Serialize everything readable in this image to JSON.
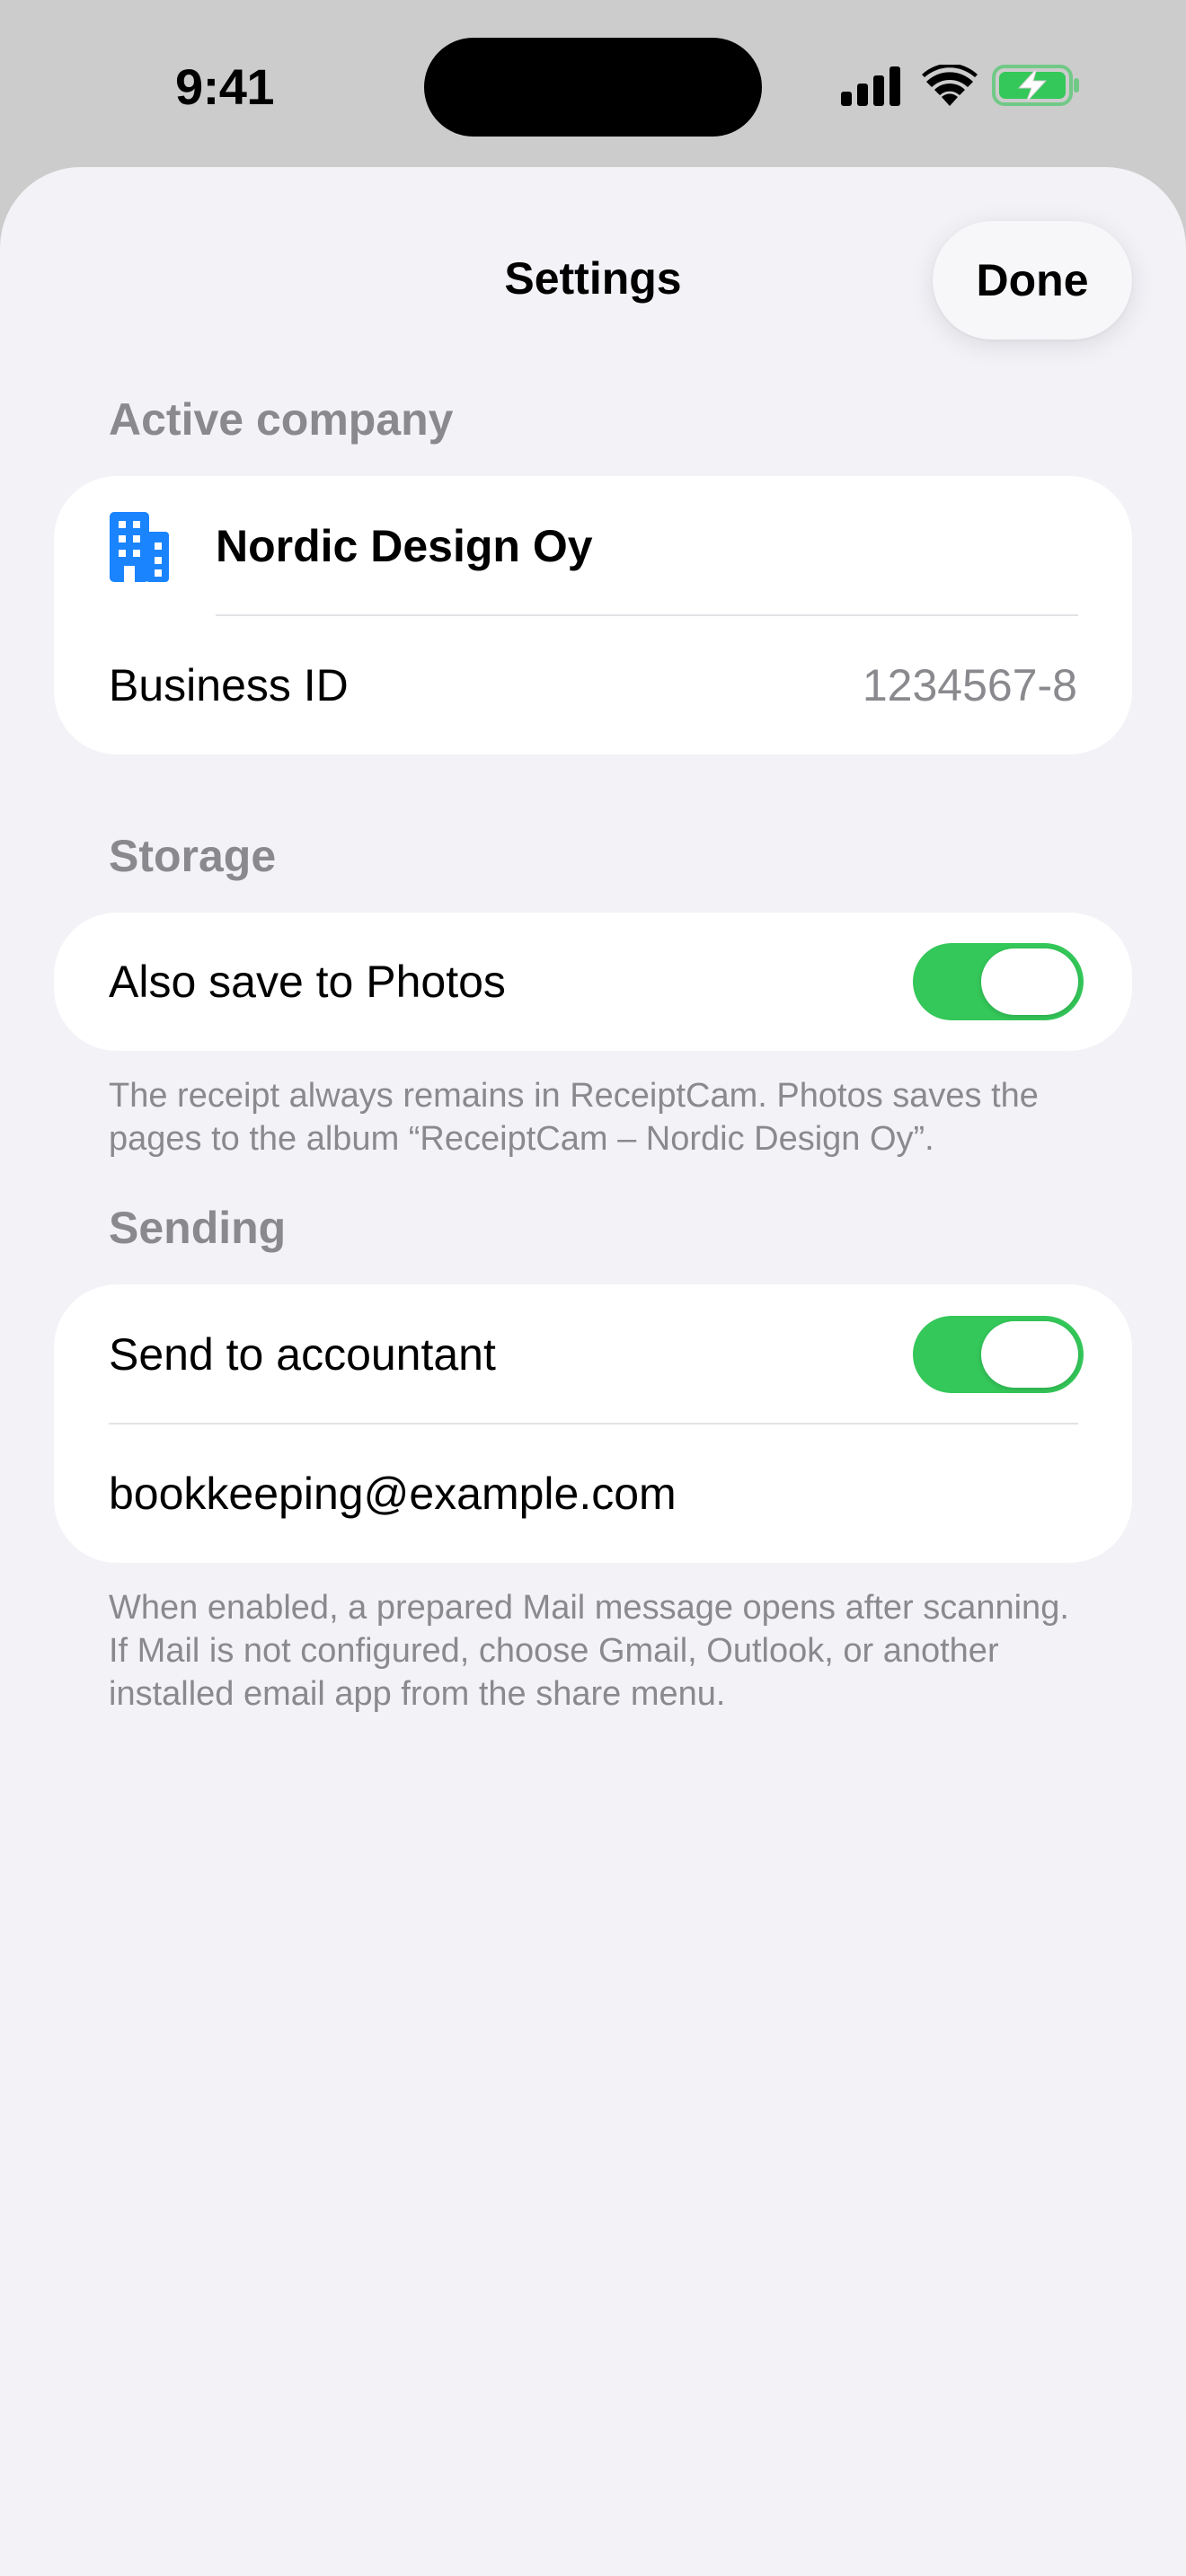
{
  "status_bar": {
    "time": "9:41",
    "icons": [
      "cellular-signal-icon",
      "wifi-icon",
      "battery-charging-icon"
    ],
    "battery_color": "#34c759"
  },
  "nav": {
    "title": "Settings",
    "done_label": "Done"
  },
  "active_company": {
    "header": "Active company",
    "company_icon": "building-icon",
    "company_name": "Nordic Design Oy",
    "business_id_label": "Business ID",
    "business_id_value": "1234567-8"
  },
  "storage": {
    "header": "Storage",
    "save_to_photos_label": "Also save to Photos",
    "save_to_photos_enabled": true,
    "note": "The receipt always remains in ReceiptCam. Photos saves the pages to the album “ReceiptCam – Nordic Design Oy”."
  },
  "sending": {
    "header": "Sending",
    "send_to_accountant_label": "Send to accountant",
    "send_to_accountant_enabled": true,
    "email": "bookkeeping@example.com",
    "note": "When enabled, a prepared Mail message opens after scanning. If Mail is not configured, choose Gmail, Outlook, or another installed email app from the share menu."
  },
  "colors": {
    "accent_blue": "#1a84ff",
    "toggle_on": "#34c759",
    "secondary_text": "#8a8a8e",
    "sheet_background": "#f2f2f7"
  }
}
